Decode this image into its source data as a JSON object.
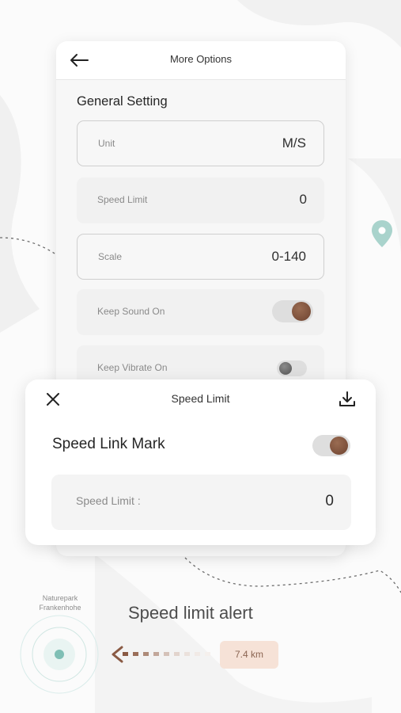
{
  "options": {
    "title": "More Options",
    "section_title": "General Setting",
    "rows": [
      {
        "label": "Unit",
        "value": "M/S"
      },
      {
        "label": "Speed Limit",
        "value": "0"
      },
      {
        "label": "Scale",
        "value": "0-140"
      },
      {
        "label": "Keep Sound On",
        "toggle": "on"
      },
      {
        "label": "Keep Vibrate On",
        "toggle": "off"
      }
    ]
  },
  "sheet": {
    "title": "Speed Limit",
    "mark_label": "Speed Link Mark",
    "mark_toggle": "on",
    "limit_label": "Speed Limit :",
    "limit_value": "0"
  },
  "illustration": {
    "park_name_line1": "Naturepark",
    "park_name_line2": "Frankenhohe",
    "alert_title": "Speed limit alert",
    "distance": "7.4 km"
  },
  "colors": {
    "accent_brown": "#7a4b36",
    "pin_teal": "#a9d3cc",
    "radar_dot": "#7fbfb5",
    "badge_bg": "#f6e2d7"
  },
  "icons": {
    "back": "arrow-left-icon",
    "close": "close-icon",
    "download": "download-icon",
    "location": "location-pin-icon"
  }
}
